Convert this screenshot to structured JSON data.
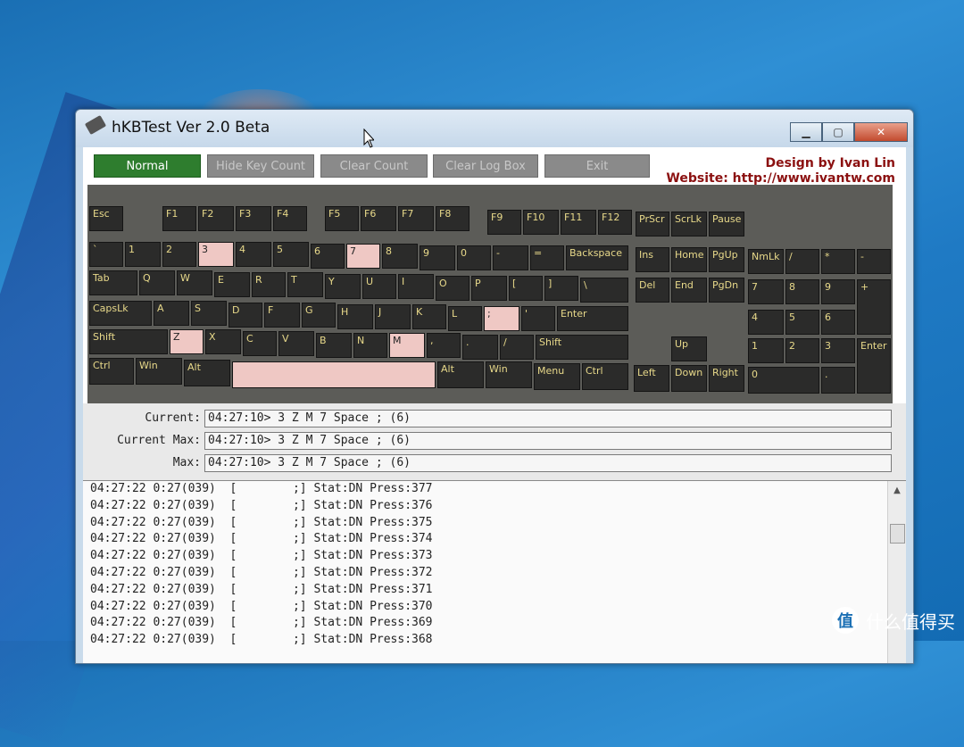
{
  "window": {
    "title": "hKBTest Ver 2.0 Beta"
  },
  "toolbar": {
    "normal": "Normal",
    "hide_key_count": "Hide Key Count",
    "clear_count": "Clear Count",
    "clear_log_box": "Clear Log Box",
    "exit": "Exit",
    "credit_line1": "Design by Ivan Lin",
    "credit_line2": "Website: http://www.ivantw.com"
  },
  "keys": {
    "esc": "Esc",
    "f1": "F1",
    "f2": "F2",
    "f3": "F3",
    "f4": "F4",
    "f5": "F5",
    "f6": "F6",
    "f7": "F7",
    "f8": "F8",
    "f9": "F9",
    "f10": "F10",
    "f11": "F11",
    "f12": "F12",
    "prscr": "PrScr",
    "scrlk": "ScrLk",
    "pause": "Pause",
    "backtick": "`",
    "n1": "1",
    "n2": "2",
    "n3": "3",
    "n4": "4",
    "n5": "5",
    "n6": "6",
    "n7": "7",
    "n8": "8",
    "n9": "9",
    "n0": "0",
    "minus": "-",
    "equal": "=",
    "backspace": "Backspace",
    "ins": "Ins",
    "home": "Home",
    "pgup": "PgUp",
    "nmlk": "NmLk",
    "kp_div": "/",
    "kp_mul": "*",
    "kp_minus": "-",
    "tab": "Tab",
    "q": "Q",
    "w": "W",
    "e": "E",
    "r": "R",
    "t": "T",
    "y": "Y",
    "u": "U",
    "i": "I",
    "o": "O",
    "p": "P",
    "lbracket": "[",
    "rbracket": "]",
    "backslash": "\\",
    "del": "Del",
    "end": "End",
    "pgdn": "PgDn",
    "kp7": "7",
    "kp8": "8",
    "kp9": "9",
    "kp_plus": "+",
    "capslk": "CapsLk",
    "a": "A",
    "s": "S",
    "d": "D",
    "f": "F",
    "g": "G",
    "h": "H",
    "j": "J",
    "k": "K",
    "l": "L",
    "semicolon": ";",
    "quote": "'",
    "enter": "Enter",
    "kp4": "4",
    "kp5": "5",
    "kp6": "6",
    "lshift": "Shift",
    "z": "Z",
    "x": "X",
    "c": "C",
    "v": "V",
    "b": "B",
    "n": "N",
    "m": "M",
    "comma": ",",
    "period": ".",
    "slash": "/",
    "rshift": "Shift",
    "up": "Up",
    "kp1": "1",
    "kp2": "2",
    "kp3": "3",
    "kp_enter": "Enter",
    "lctrl": "Ctrl",
    "lwin": "Win",
    "lalt": "Alt",
    "space": "",
    "ralt": "Alt",
    "rwin": "Win",
    "menu": "Menu",
    "rctrl": "Ctrl",
    "left": "Left",
    "down": "Down",
    "right": "Right",
    "kp0": "0",
    "kp_dot": "."
  },
  "status": {
    "current_label": "Current:",
    "current_value": "04:27:10> 3 Z M 7 Space ; (6)",
    "current_max_label": "Current Max:",
    "current_max_value": "04:27:10> 3 Z M 7 Space ; (6)",
    "max_label": "Max:",
    "max_value": "04:27:10> 3 Z M 7 Space ; (6)"
  },
  "log": [
    "04:27:22 0:27(039)  [        ;] Stat:DN Press:377",
    "04:27:22 0:27(039)  [        ;] Stat:DN Press:376",
    "04:27:22 0:27(039)  [        ;] Stat:DN Press:375",
    "04:27:22 0:27(039)  [        ;] Stat:DN Press:374",
    "04:27:22 0:27(039)  [        ;] Stat:DN Press:373",
    "04:27:22 0:27(039)  [        ;] Stat:DN Press:372",
    "04:27:22 0:27(039)  [        ;] Stat:DN Press:371",
    "04:27:22 0:27(039)  [        ;] Stat:DN Press:370",
    "04:27:22 0:27(039)  [        ;] Stat:DN Press:369",
    "04:27:22 0:27(039)  [        ;] Stat:DN Press:368"
  ],
  "watermark": {
    "icon": "值",
    "text": "什么值得买"
  }
}
